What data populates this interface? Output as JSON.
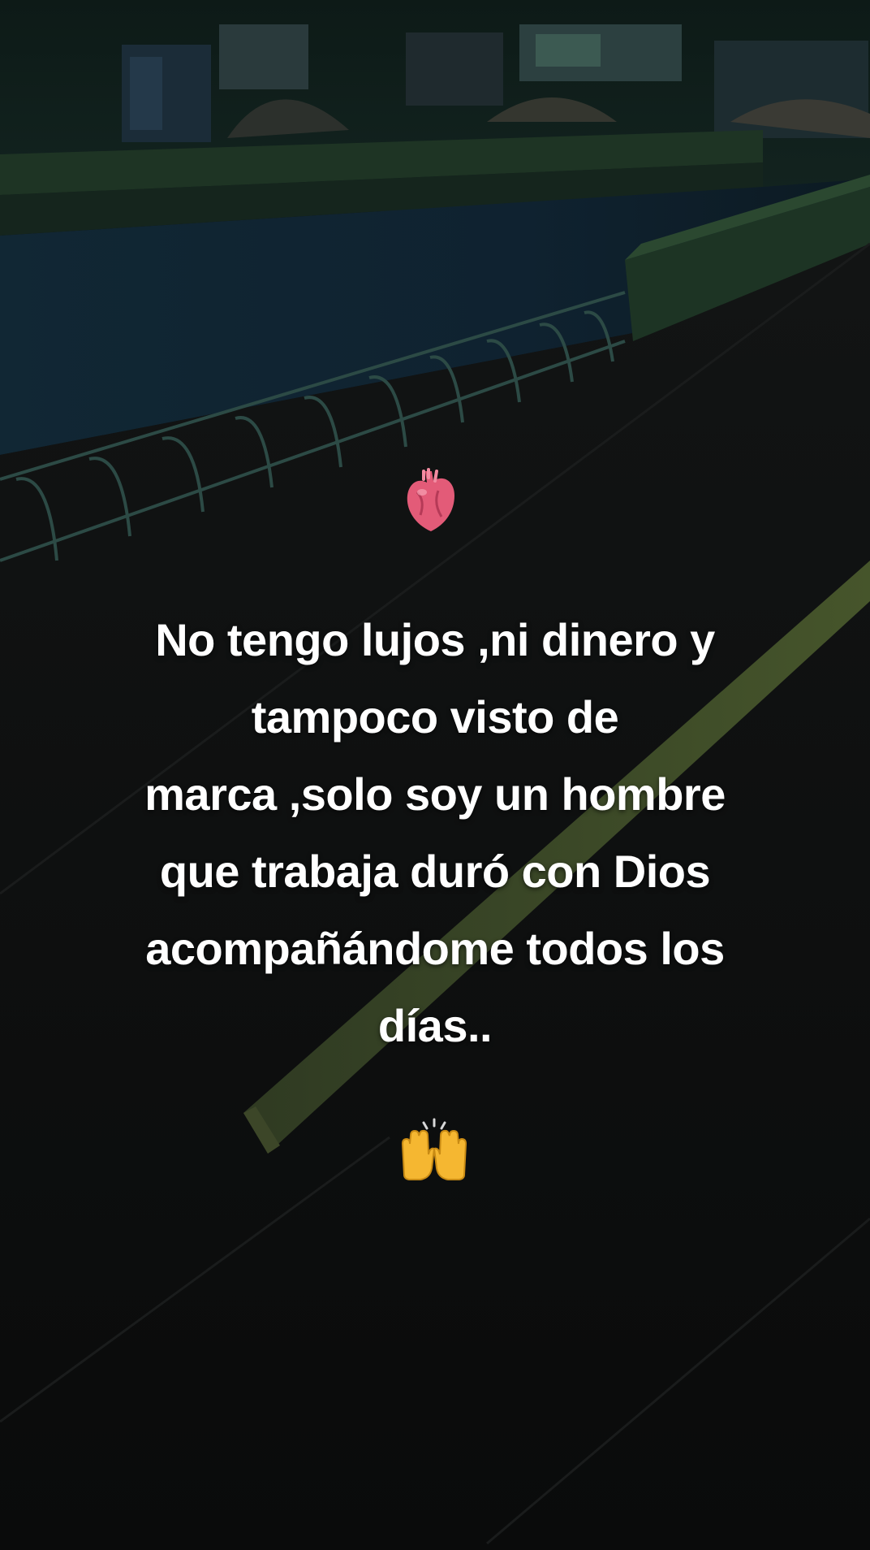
{
  "post": {
    "text_lines": [
      "No tengo lujos ,ni dinero y",
      "tampoco visto de",
      "marca ,solo soy un hombre",
      "que trabaja duró con Dios",
      "acompañándome todos los",
      "días.."
    ]
  },
  "icons": {
    "top": "anatomical-heart-icon",
    "bottom": "raising-hands-icon"
  },
  "colors": {
    "text": "#ffffff",
    "background": "#0c0d0d"
  }
}
